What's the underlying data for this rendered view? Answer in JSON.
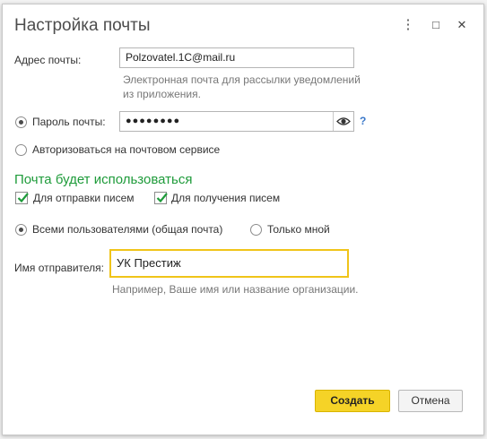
{
  "window": {
    "title": "Настройка почты",
    "menu_icon": "⋮",
    "maximize_icon": "□",
    "close_icon": "✕"
  },
  "email": {
    "label": "Адрес почты:",
    "value": "Polzovatel.1C@mail.ru",
    "hint_line1": "Электронная почта для рассылки уведомлений",
    "hint_line2": "из приложения."
  },
  "password": {
    "option_label": "Пароль почты:",
    "value": "●●●●●●●●",
    "selected": true,
    "help": "?"
  },
  "oauth": {
    "option_label": "Авторизоваться на почтовом сервисе",
    "selected": false
  },
  "usage": {
    "heading": "Почта будет использоваться",
    "send_label": "Для отправки писем",
    "send_checked": true,
    "receive_label": "Для получения писем",
    "receive_checked": true
  },
  "scope": {
    "all_users_label": "Всеми пользователями (общая почта)",
    "all_users_selected": true,
    "only_me_label": "Только мной",
    "only_me_selected": false
  },
  "sender": {
    "label": "Имя отправителя:",
    "value": "УК Престиж",
    "hint": "Например, Ваше имя или название организации."
  },
  "buttons": {
    "create": "Создать",
    "cancel": "Отмена"
  },
  "colors": {
    "accent_yellow": "#f5d327",
    "section_green": "#1e9b3a",
    "help_blue": "#3a78c9",
    "focus_border": "#f0c419"
  }
}
